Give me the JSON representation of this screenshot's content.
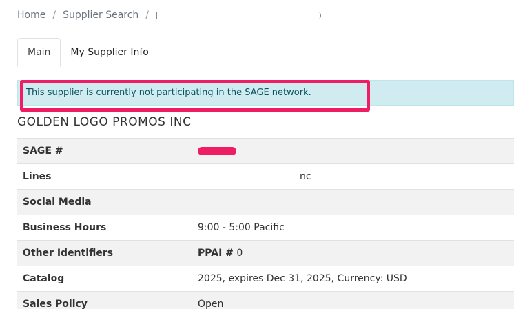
{
  "breadcrumb": {
    "home": "Home",
    "supplier_search": "Supplier Search",
    "separator": "/"
  },
  "tabs": [
    {
      "label": "Main",
      "active": true
    },
    {
      "label": "My Supplier Info",
      "active": false
    }
  ],
  "alert": {
    "message": "This supplier is currently not participating in the SAGE network."
  },
  "supplier": {
    "name": "GOLDEN LOGO PROMOS INC"
  },
  "table": {
    "rows": [
      {
        "label": "SAGE #",
        "value": ""
      },
      {
        "label": "Lines",
        "value": "nc"
      },
      {
        "label": "Social Media",
        "value": ""
      },
      {
        "label": "Business Hours",
        "value": "9:00 - 5:00 Pacific"
      },
      {
        "label": "Other Identifiers",
        "value_label": "PPAI #",
        "value": "0"
      },
      {
        "label": "Catalog",
        "value": "2025, expires Dec 31, 2025, Currency: USD"
      },
      {
        "label": "Sales Policy",
        "value": "Open"
      }
    ]
  },
  "colors": {
    "highlight": "#ee1d64",
    "alert_bg": "#d1ecf1",
    "alert_text": "#0c5460"
  }
}
